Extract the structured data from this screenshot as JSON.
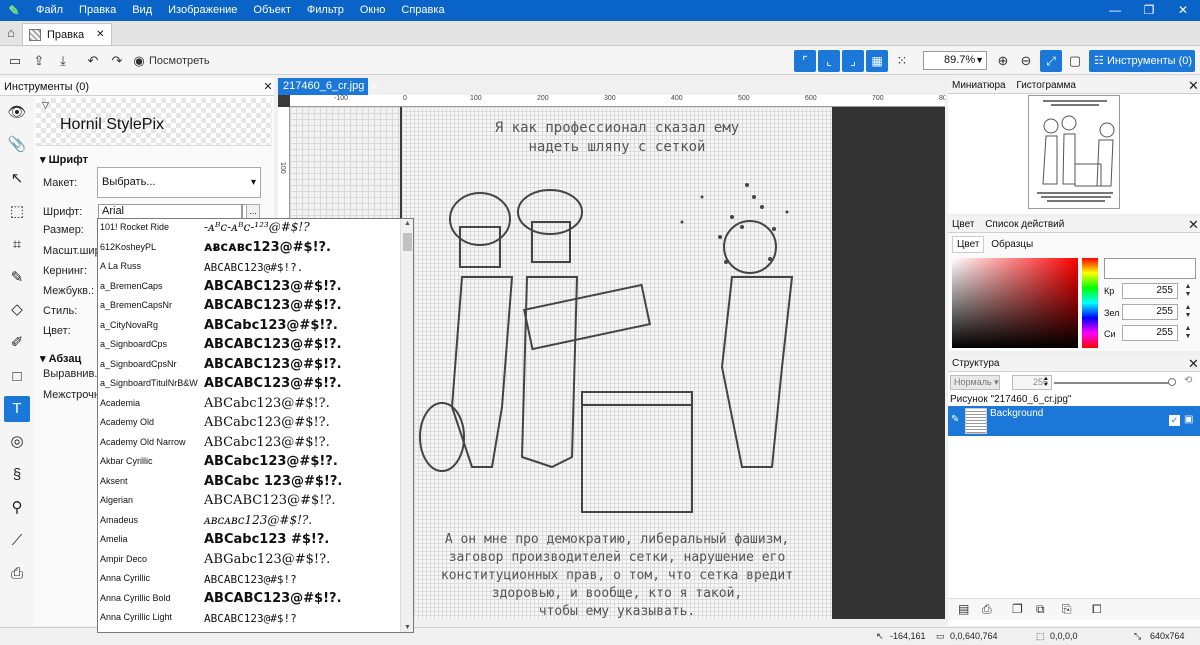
{
  "menubar": {
    "items": [
      "Файл",
      "Правка",
      "Вид",
      "Изображение",
      "Объект",
      "Фильтр",
      "Окно",
      "Справка"
    ],
    "window_controls": {
      "minimize": "—",
      "maximize": "❐",
      "close": "✕"
    }
  },
  "tabstrip": {
    "tab_label": "Правка",
    "close": "✕"
  },
  "toolbar": {
    "view_label": "Посмотреть",
    "zoom": "89.7%",
    "tools_button": "Инструменты (0)"
  },
  "left_panel": {
    "title": "Инструменты (0)",
    "preset_preview": "Hornil StylePix",
    "section_font": "Шрифт",
    "layout_label": "Макет:",
    "layout_value": "Выбрать...",
    "font_label": "Шрифт:",
    "font_value": "Arial",
    "more_button": "...",
    "size_label": "Размер:",
    "scale_label": "Масшт.шир.:",
    "kerning_label": "Кернинг:",
    "letterspace_label": "Межбукв.:",
    "style_label": "Стиль:",
    "color_label": "Цвет:",
    "section_para": "Абзац",
    "align_label": "Выравнив.:",
    "linespace_label": "Межстрочн.:"
  },
  "font_list": [
    {
      "name": "101! Rocket Ride",
      "preview": "-ᴀᴮᴄ-ᴀᴮᴄ-¹²³@#$!?",
      "style": "i"
    },
    {
      "name": "612KosheyPL",
      "preview": "ᴀᴃᴄᴀʙᴄ123@#$!?.",
      "style": "b"
    },
    {
      "name": "A La Russ",
      "preview": "ABCABC123@#$!?.",
      "style": "m"
    },
    {
      "name": "a_BremenCaps",
      "preview": "ABCABC123@#$!?.",
      "style": "b"
    },
    {
      "name": "a_BremenCapsNr",
      "preview": "ABCABC123@#$!?.",
      "style": "b"
    },
    {
      "name": "a_CityNovaRg",
      "preview": "ABCabc123@#$!?.",
      "style": "b"
    },
    {
      "name": "a_SignboardCps",
      "preview": "ABCABC123@#$!?.",
      "style": "b"
    },
    {
      "name": "a_SignboardCpsNr",
      "preview": "ABCABC123@#$!?.",
      "style": "b"
    },
    {
      "name": "a_SignboardTitulNrB&W",
      "preview": "ABCABC123@#$!?.",
      "style": "b"
    },
    {
      "name": "Academia",
      "preview": "ABCabc123@#$!?.",
      "style": "s"
    },
    {
      "name": "Academy Old",
      "preview": "ABCabc123@#$!?.",
      "style": "s"
    },
    {
      "name": "Academy Old Narrow",
      "preview": "ABCabc123@#$!?.",
      "style": "s"
    },
    {
      "name": "Akbar Cyrillic",
      "preview": "ABCabc123@#$!?.",
      "style": "b"
    },
    {
      "name": "Aksent",
      "preview": "ABCabc 123@#$!?.",
      "style": "b"
    },
    {
      "name": "Algerian",
      "preview": "ABCABC123@#$!?.",
      "style": "s"
    },
    {
      "name": "Amadeus",
      "preview": "ᴀʙᴄᴀʙᴄ123@#$!?.",
      "style": "i"
    },
    {
      "name": "Amelia",
      "preview": "ABCabc123 #$!?.",
      "style": "b"
    },
    {
      "name": "Ampir Deco",
      "preview": "ABGabc123@#$!?.",
      "style": "s"
    },
    {
      "name": "Anna Cyrillic",
      "preview": "ABCABC123@#$!?",
      "style": "m"
    },
    {
      "name": "Anna Cyrillic Bold",
      "preview": "ABCABC123@#$!?.",
      "style": "b"
    },
    {
      "name": "Anna Cyrillic Light",
      "preview": "ABCABC123@#$!?",
      "style": "m"
    }
  ],
  "document": {
    "tab": "217460_6_cr.jpg",
    "ruler_top": [
      "-100",
      "0",
      "100",
      "200",
      "300",
      "400",
      "500",
      "600",
      "700",
      "800"
    ],
    "ruler_left": [
      "100"
    ],
    "image_title": "Я как профессионал сказал ему\nнадеть шляпу с сеткой",
    "image_caption": "А он мне про демократию, либеральный фашизм,\nзаговор производителей сетки, нарушение его\nконституционных прав, о том, что сетка вредит\nздоровью, и вообще, кто я такой,\nчтобы ему указывать."
  },
  "navigator": {
    "tab1": "Миниатюра",
    "tab2": "Гистограмма"
  },
  "color_panel": {
    "tab1": "Цвет",
    "tab2": "Список действий",
    "subtab1": "Цвет",
    "subtab2": "Образцы",
    "red_label": "Кр",
    "green_label": "Зел",
    "blue_label": "Си",
    "red": "255",
    "green": "255",
    "blue": "255"
  },
  "layers": {
    "title": "Структура",
    "blend_mode": "Нормаль",
    "opacity": "255",
    "picture_label": "Рисунок \"217460_6_cr.jpg\"",
    "layer_name": "Background"
  },
  "status": {
    "cursor": "-164,161",
    "selection": "0,0,640,764",
    "zero": "0,0,0,0",
    "size": "640x764"
  }
}
